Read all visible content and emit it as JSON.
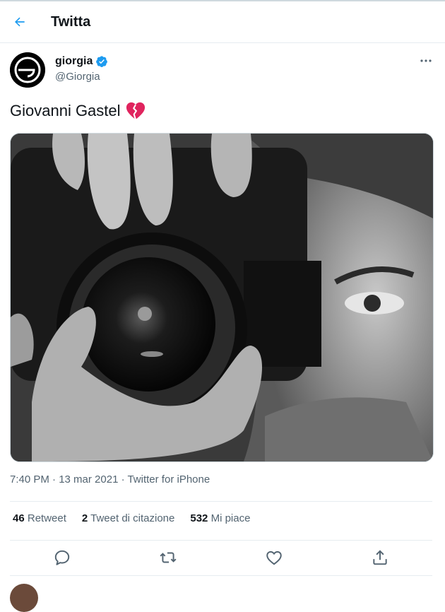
{
  "header": {
    "title": "Twitta"
  },
  "tweet": {
    "author_name": "giorgia",
    "author_handle": "@Giorgia",
    "text": "Giovanni Gastel",
    "emoji": "broken-heart",
    "media_description": "",
    "meta": "7:40 PM · 13 mar 2021 · Twitter for iPhone",
    "stats": {
      "retweets_count": "46",
      "retweets_label": "Retweet",
      "quotes_count": "2",
      "quotes_label": "Tweet di citazione",
      "likes_count": "532",
      "likes_label": "Mi piace"
    }
  },
  "icons": {
    "back": "arrow-left-icon",
    "verified": "verified-badge-icon",
    "more": "more-horizontal-icon",
    "reply": "reply-icon",
    "retweet": "retweet-icon",
    "like": "heart-icon",
    "share": "share-icon"
  },
  "colors": {
    "accent": "#1d9bf0",
    "heart_red": "#e0245e",
    "muted_text": "#536471"
  }
}
